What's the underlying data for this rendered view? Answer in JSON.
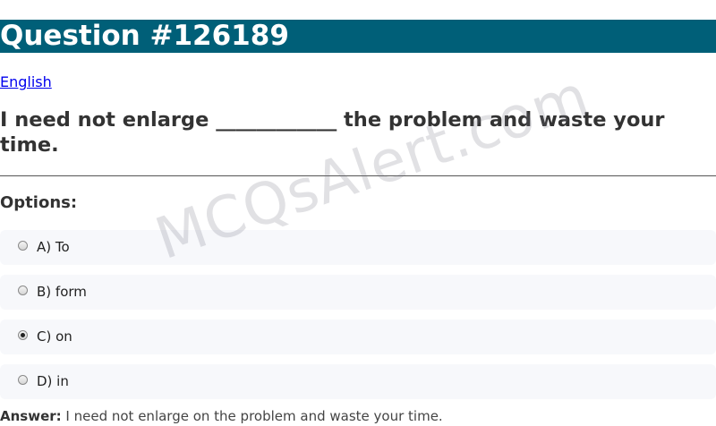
{
  "header": {
    "title": "Question #126189"
  },
  "language_link": "English",
  "question": {
    "text": "I need not enlarge ____________ the problem and waste your time."
  },
  "options_label": "Options:",
  "options": [
    {
      "label": "A) To",
      "selected": false
    },
    {
      "label": "B) form",
      "selected": false
    },
    {
      "label": "C) on",
      "selected": true
    },
    {
      "label": "D) in",
      "selected": false
    }
  ],
  "answer": {
    "label": "Answer:",
    "text": " I need not enlarge on the problem and waste your time."
  },
  "watermark": "MCQsAlert.com",
  "colors": {
    "header_bg": "#005f78",
    "option_bg": "#f7f8fb",
    "link": "#0000ee"
  },
  "icons": [
    "radio-icon"
  ]
}
